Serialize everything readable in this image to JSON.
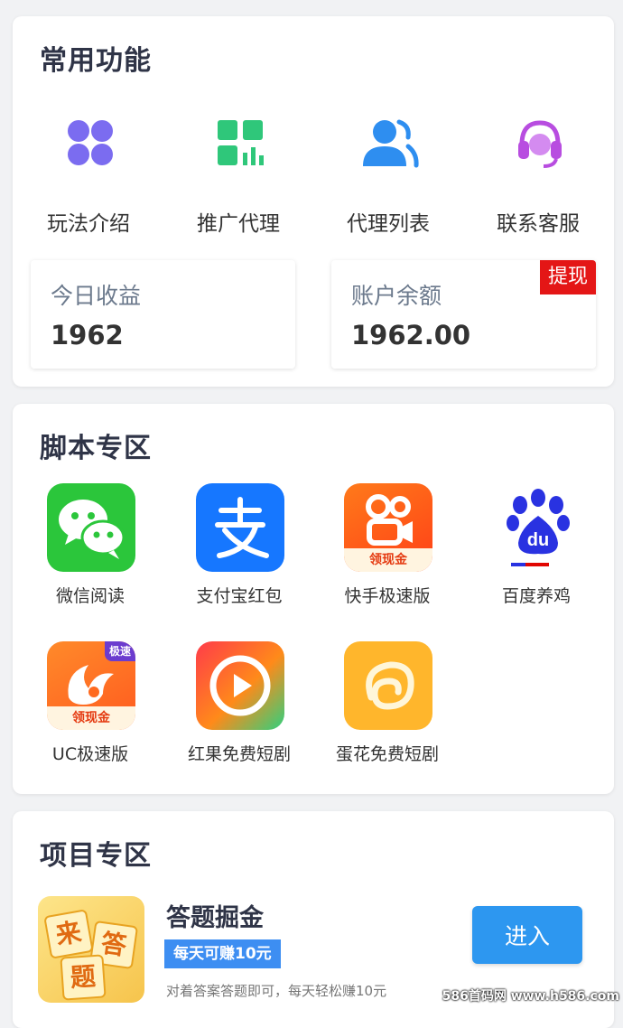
{
  "common_functions": {
    "title": "常用功能",
    "items": [
      {
        "label": "玩法介绍",
        "icon": "grid-icon"
      },
      {
        "label": "推广代理",
        "icon": "bar-grid-icon"
      },
      {
        "label": "代理列表",
        "icon": "users-icon"
      },
      {
        "label": "联系客服",
        "icon": "headset-icon"
      }
    ],
    "today_income": {
      "label": "今日收益",
      "value": "1962"
    },
    "balance": {
      "label": "账户余额",
      "value": "1962.00",
      "withdraw_label": "提现"
    }
  },
  "script_zone": {
    "title": "脚本专区",
    "apps": [
      {
        "label": "微信阅读",
        "icon": "wechat-icon"
      },
      {
        "label": "支付宝红包",
        "icon": "alipay-icon"
      },
      {
        "label": "快手极速版",
        "icon": "kuaishou-icon",
        "badge": "领现金"
      },
      {
        "label": "百度养鸡",
        "icon": "baidu-icon",
        "logo_text": "du"
      },
      {
        "label": "UC极速版",
        "icon": "uc-icon",
        "badge": "领现金",
        "corner": "极速"
      },
      {
        "label": "红果免费短剧",
        "icon": "hongguo-icon"
      },
      {
        "label": "蛋花免费短剧",
        "icon": "danhua-icon"
      }
    ]
  },
  "project_zone": {
    "title": "项目专区",
    "project": {
      "name": "答题掘金",
      "badge": "每天可赚10元",
      "description": "对着答案答题即可，每天轻松赚10元",
      "enter_label": "进入",
      "thumb_chars": [
        "来",
        "答",
        "题"
      ]
    }
  },
  "watermark": "586首码网 www.h586.com",
  "colors": {
    "accent": "#2d97f0",
    "withdraw": "#e41616",
    "title": "#2f3447"
  }
}
